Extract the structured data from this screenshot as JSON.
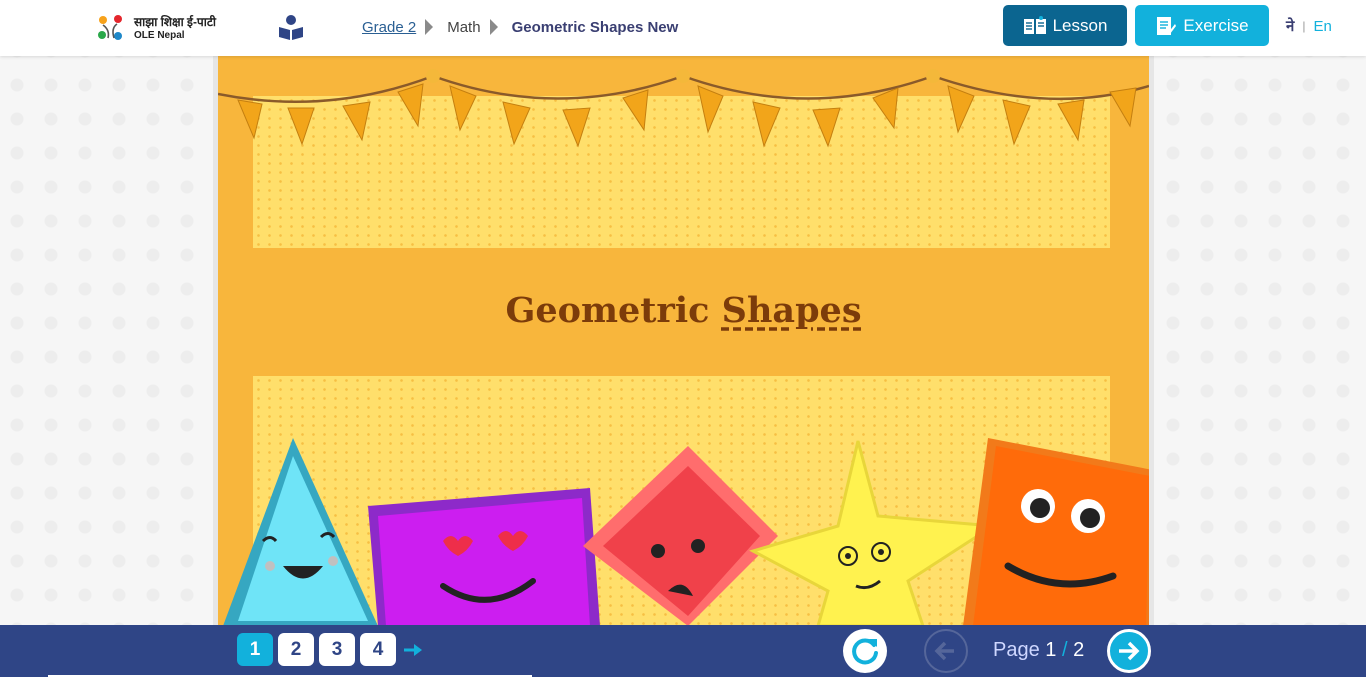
{
  "header": {
    "logo": {
      "text_np": "साझा शिक्षा ई-पाटी",
      "text_en": "OLE Nepal"
    },
    "breadcrumb": {
      "grade": "Grade 2",
      "subject": "Math",
      "current": "Geometric Shapes New"
    },
    "buttons": {
      "lesson": "Lesson",
      "exercise": "Exercise"
    },
    "language": {
      "nepali": "ने",
      "separator": "|",
      "english": "En"
    }
  },
  "content": {
    "title_part1": "Geometric ",
    "title_part2": "Shapes"
  },
  "footer": {
    "pages": [
      "1",
      "2",
      "3",
      "4"
    ],
    "active_page": "1",
    "page_label": "Page ",
    "current_page": "1",
    "page_separator": " / ",
    "total_pages": "2"
  },
  "colors": {
    "header_bg": "#ffffff",
    "lesson_button": "#0b6590",
    "exercise_button": "#12b1dc",
    "content_bg": "#f8b63c",
    "panel_bg": "#ffdf6b",
    "title_color": "#7c3c0a",
    "footer_bg": "#2f4586"
  },
  "icons": {
    "reader": "reader-icon",
    "lesson": "lesson-book-icon",
    "exercise": "exercise-notepad-icon",
    "next_pages": "arrow-right-icon",
    "refresh": "refresh-icon",
    "previous": "arrow-left-circle-icon",
    "next": "arrow-right-circle-icon"
  }
}
